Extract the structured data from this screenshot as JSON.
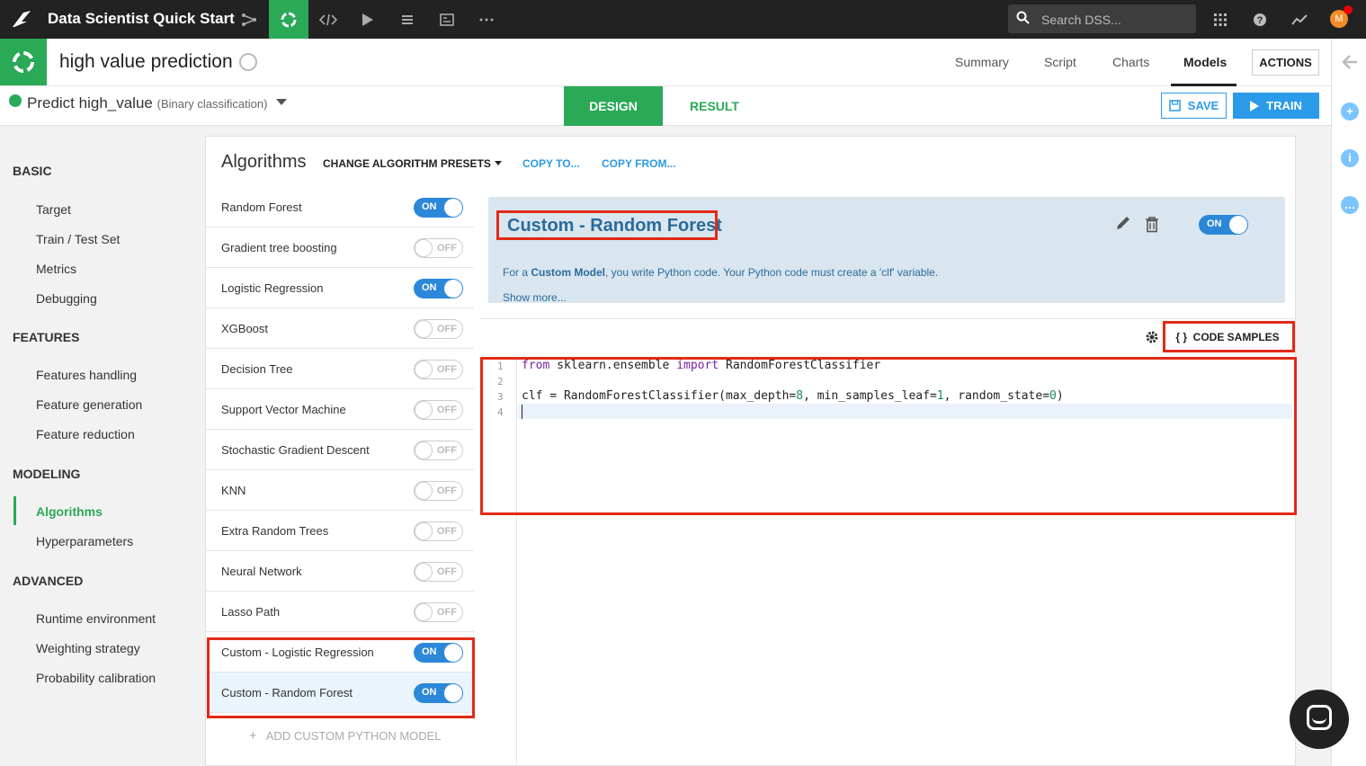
{
  "topbar": {
    "project_title": "Data Scientist Quick Start",
    "search_placeholder": "Search DSS...",
    "avatar_initial": "M"
  },
  "header": {
    "title": "high value prediction",
    "tabs": [
      "Summary",
      "Script",
      "Charts",
      "Models"
    ],
    "active_tab": "Models",
    "actions_label": "ACTIONS"
  },
  "subheader": {
    "title": "Predict high_value",
    "subtitle": "(Binary classification)",
    "design_label": "DESIGN",
    "result_label": "RESULT",
    "save_label": "SAVE",
    "train_label": "TRAIN"
  },
  "sidebar": {
    "sections": [
      {
        "title": "BASIC",
        "items": [
          "Target",
          "Train / Test Set",
          "Metrics",
          "Debugging"
        ]
      },
      {
        "title": "FEATURES",
        "items": [
          "Features handling",
          "Feature generation",
          "Feature reduction"
        ]
      },
      {
        "title": "MODELING",
        "items": [
          "Algorithms",
          "Hyperparameters"
        ]
      },
      {
        "title": "ADVANCED",
        "items": [
          "Runtime environment",
          "Weighting strategy",
          "Probability calibration"
        ]
      }
    ],
    "active_item": "Algorithms"
  },
  "algorithms": {
    "heading": "Algorithms",
    "preset_label": "CHANGE ALGORITHM PRESETS",
    "copy_to": "COPY TO...",
    "copy_from": "COPY FROM...",
    "on_label": "ON",
    "off_label": "OFF",
    "list": [
      {
        "name": "Random Forest",
        "on": true
      },
      {
        "name": "Gradient tree boosting",
        "on": false
      },
      {
        "name": "Logistic Regression",
        "on": true
      },
      {
        "name": "XGBoost",
        "on": false
      },
      {
        "name": "Decision Tree",
        "on": false
      },
      {
        "name": "Support Vector Machine",
        "on": false
      },
      {
        "name": "Stochastic Gradient Descent",
        "on": false
      },
      {
        "name": "KNN",
        "on": false
      },
      {
        "name": "Extra Random Trees",
        "on": false
      },
      {
        "name": "Neural Network",
        "on": false
      },
      {
        "name": "Lasso Path",
        "on": false
      },
      {
        "name": "Custom - Logistic Regression",
        "on": true
      },
      {
        "name": "Custom - Random Forest",
        "on": true,
        "selected": true
      }
    ],
    "add_custom_label": "ADD CUSTOM PYTHON MODEL"
  },
  "detail": {
    "title": "Custom - Random Forest",
    "desc_prefix": "For a ",
    "desc_bold": "Custom Model",
    "desc_suffix": ", you write Python code. Your Python code must create a 'clf' variable.",
    "show_more": "Show more...",
    "code_samples_label": "CODE SAMPLES",
    "code_samples_glyph": "{ }"
  },
  "code": {
    "line_numbers": [
      "1",
      "2",
      "3",
      "4"
    ],
    "line1": {
      "kw1": "from",
      "mod": " sklearn.ensemble ",
      "kw2": "import",
      "cls": " RandomForestClassifier"
    },
    "line3": {
      "a": "clf = RandomForestClassifier(max_depth=",
      "n1": "8",
      "b": ", min_samples_leaf=",
      "n2": "1",
      "c": ", random_state=",
      "n3": "0",
      "d": ")"
    }
  },
  "colors": {
    "accent_green": "#2aa957",
    "accent_blue": "#2b9ae8",
    "highlight_red": "#e22a16"
  }
}
